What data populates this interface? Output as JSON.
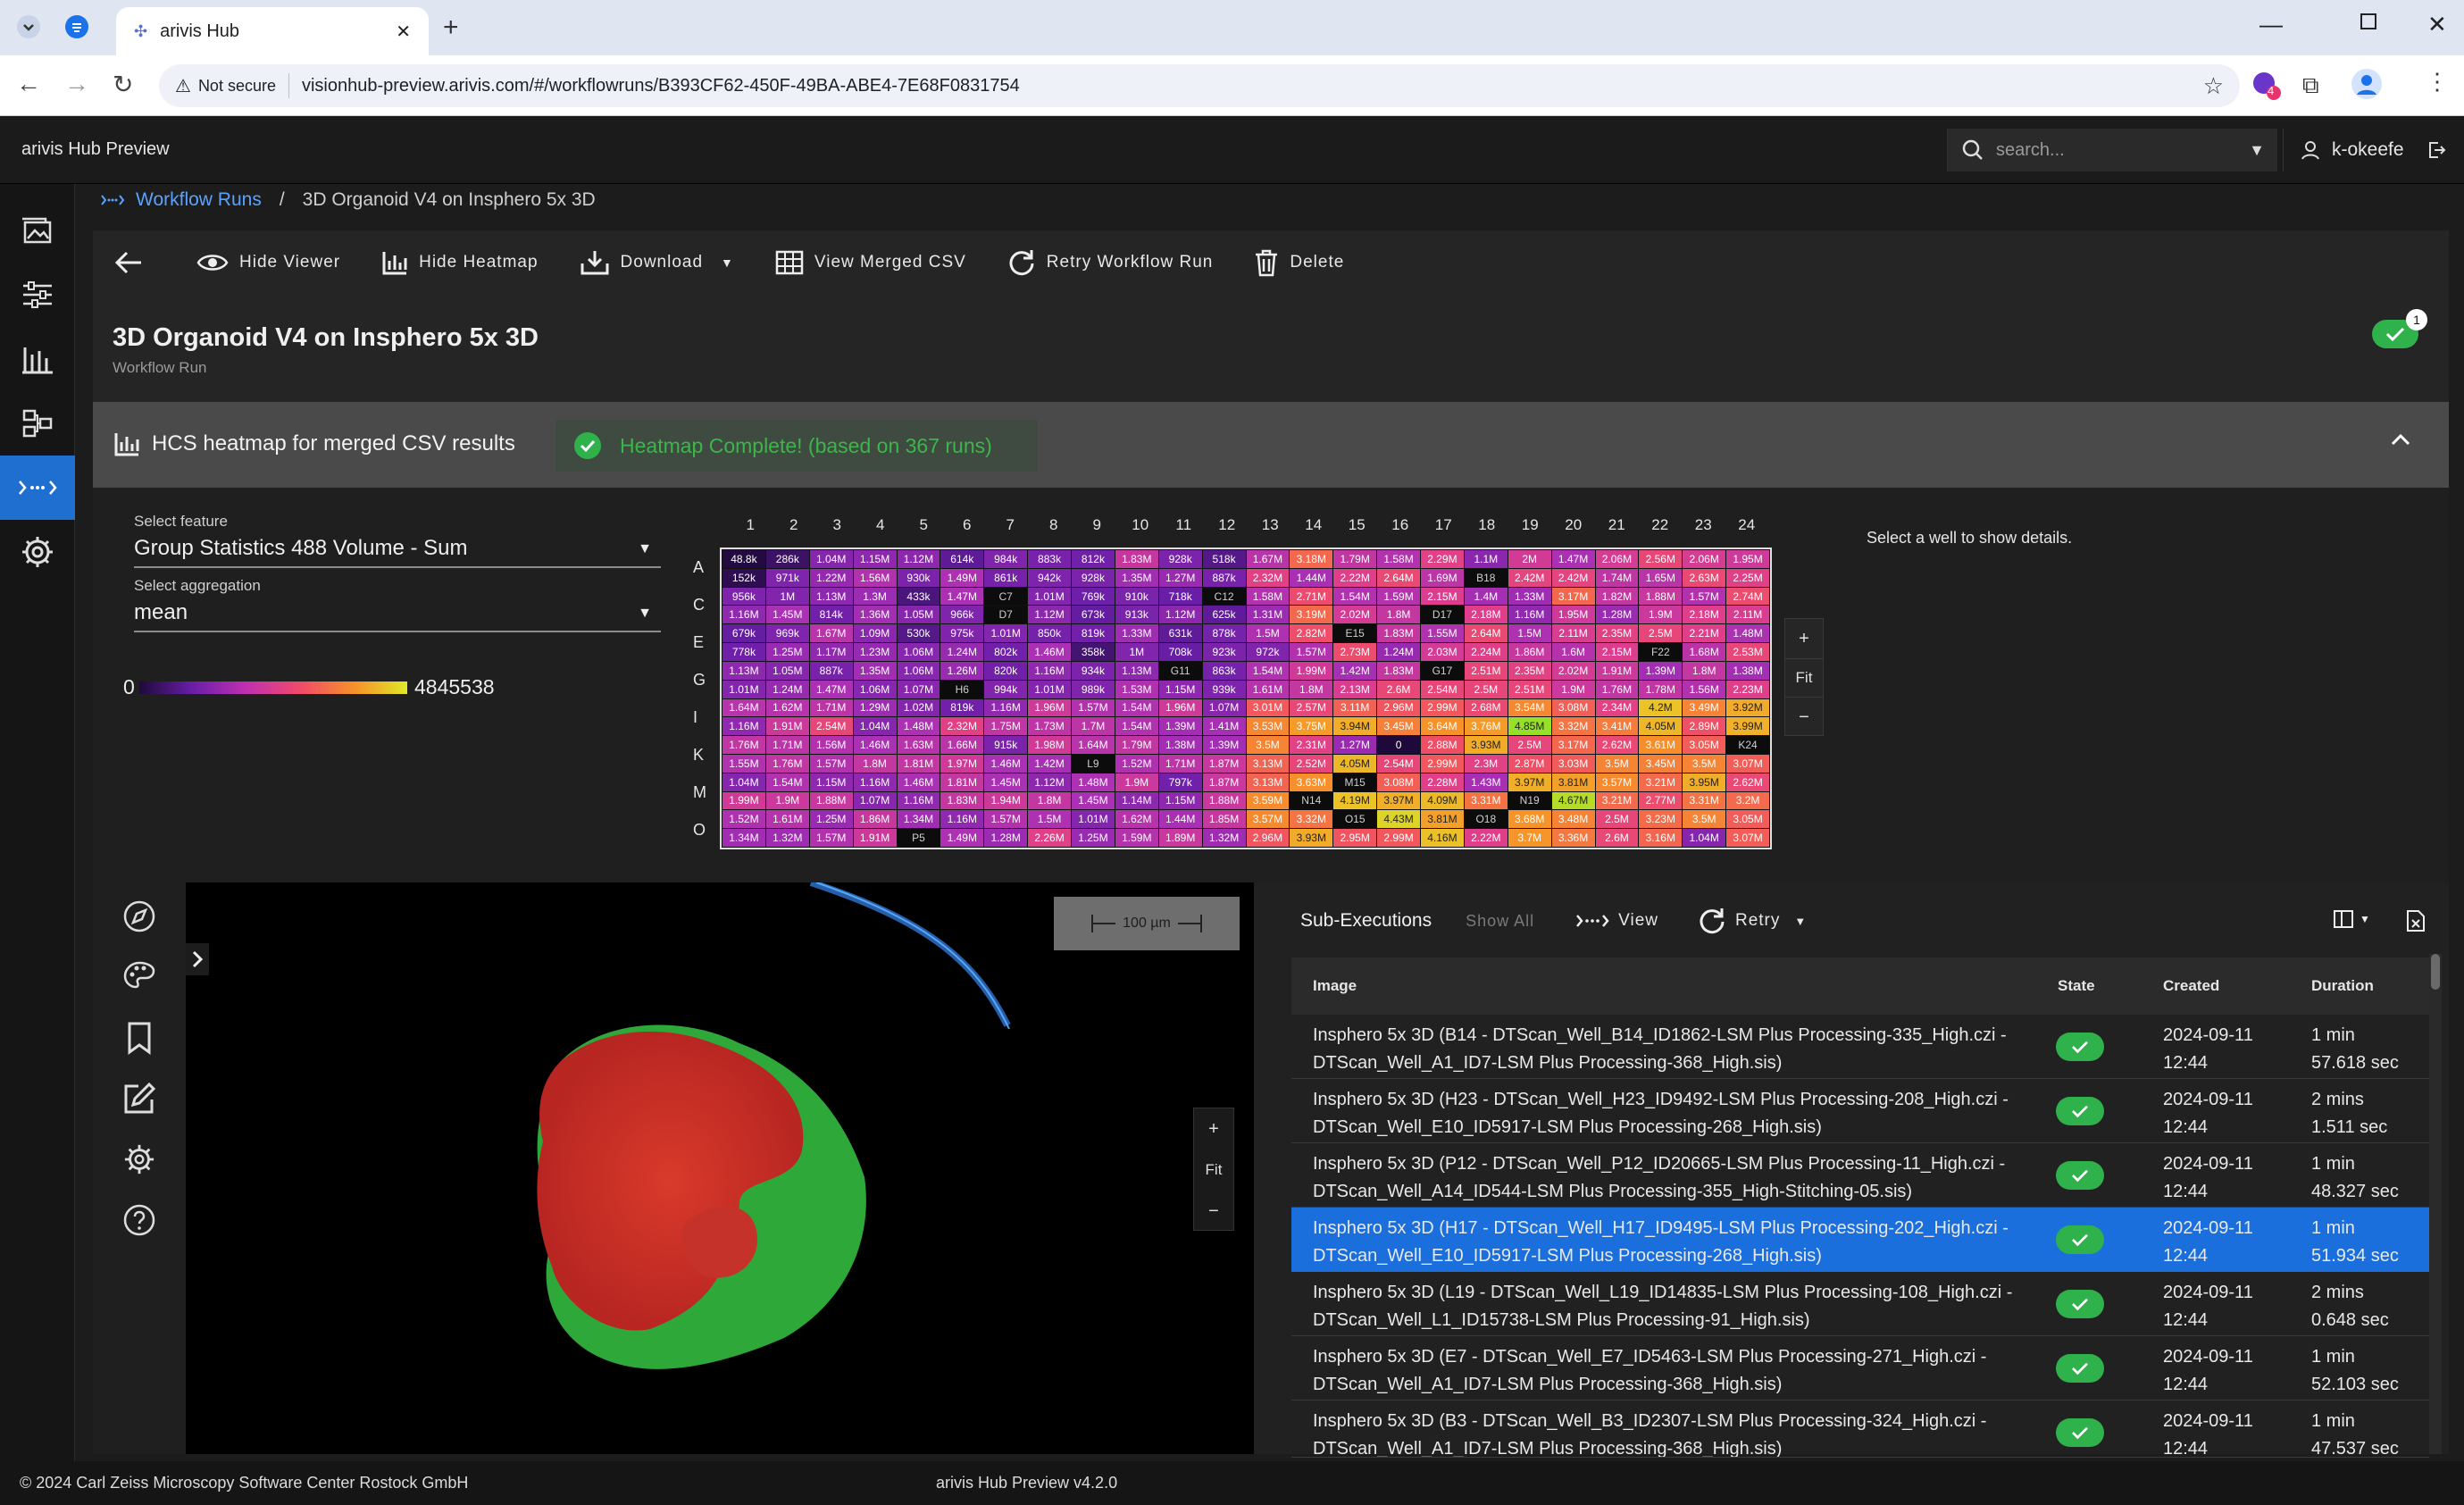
{
  "browser": {
    "tab_title": "arivis Hub",
    "not_secure": "Not secure",
    "url": "visionhub-preview.arivis.com/#/workflowruns/B393CF62-450F-49BA-ABE4-7E68F0831754",
    "extension_badge": "4"
  },
  "app": {
    "name": "arivis Hub Preview",
    "search_placeholder": "search...",
    "username": "k-okeefe"
  },
  "breadcrumb": {
    "parent": "Workflow Runs",
    "separator": "/",
    "current": "3D Organoid V4 on Insphero 5x 3D"
  },
  "toolbar": {
    "hide_viewer": "Hide Viewer",
    "hide_heatmap": "Hide Heatmap",
    "download": "Download",
    "view_csv": "View Merged CSV",
    "retry": "Retry Workflow Run",
    "delete": "Delete"
  },
  "page": {
    "title": "3D Organoid V4 on Insphero 5x 3D",
    "subtitle": "Workflow Run",
    "status_badge_count": "1"
  },
  "heatmap": {
    "section_title": "HCS heatmap for merged CSV results",
    "status": "Heatmap Complete! (based on 367 runs)",
    "feature_label": "Select feature",
    "feature_value": "Group Statistics 488 Volume - Sum",
    "aggregation_label": "Select aggregation",
    "aggregation_value": "mean",
    "scale_min": "0",
    "scale_max": "4845538",
    "well_hint": "Select a well to show details.",
    "zoom_in": "+",
    "zoom_fit": "Fit",
    "zoom_out": "−",
    "column_labels": [
      "1",
      "2",
      "3",
      "4",
      "5",
      "6",
      "7",
      "8",
      "9",
      "10",
      "11",
      "12",
      "13",
      "14",
      "15",
      "16",
      "17",
      "18",
      "19",
      "20",
      "21",
      "22",
      "23",
      "24"
    ],
    "row_labels": [
      "A",
      "C",
      "E",
      "G",
      "I",
      "K",
      "M",
      "O"
    ],
    "rows": [
      [
        "48.8k",
        "286k",
        "1.04M",
        "1.15M",
        "1.12M",
        "614k",
        "984k",
        "883k",
        "812k",
        "1.83M",
        "928k",
        "518k",
        "1.67M",
        "3.18M",
        "1.79M",
        "1.58M",
        "2.29M",
        "1.1M",
        "2M",
        "1.47M",
        "2.06M",
        "2.56M",
        "2.06M",
        "1.95M"
      ],
      [
        "152k",
        "971k",
        "1.22M",
        "1.56M",
        "930k",
        "1.49M",
        "861k",
        "942k",
        "928k",
        "1.35M",
        "1.27M",
        "887k",
        "2.32M",
        "1.44M",
        "2.22M",
        "2.64M",
        "1.69M",
        "B18",
        "2.42M",
        "2.42M",
        "1.74M",
        "1.65M",
        "2.63M",
        "2.25M"
      ],
      [
        "956k",
        "1M",
        "1.13M",
        "1.3M",
        "433k",
        "1.47M",
        "C7",
        "1.01M",
        "769k",
        "910k",
        "718k",
        "C12",
        "1.58M",
        "2.71M",
        "1.54M",
        "1.59M",
        "2.15M",
        "1.4M",
        "1.33M",
        "3.17M",
        "1.82M",
        "1.88M",
        "1.57M",
        "2.74M"
      ],
      [
        "1.16M",
        "1.45M",
        "814k",
        "1.36M",
        "1.05M",
        "966k",
        "D7",
        "1.12M",
        "673k",
        "913k",
        "1.12M",
        "625k",
        "1.31M",
        "3.19M",
        "2.02M",
        "1.8M",
        "D17",
        "2.18M",
        "1.16M",
        "1.95M",
        "1.28M",
        "1.9M",
        "2.18M",
        "2.11M"
      ],
      [
        "679k",
        "969k",
        "1.67M",
        "1.09M",
        "530k",
        "975k",
        "1.01M",
        "850k",
        "819k",
        "1.33M",
        "631k",
        "878k",
        "1.5M",
        "2.82M",
        "E15",
        "1.83M",
        "1.55M",
        "2.64M",
        "1.5M",
        "2.11M",
        "2.35M",
        "2.5M",
        "2.21M",
        "1.48M"
      ],
      [
        "778k",
        "1.25M",
        "1.17M",
        "1.23M",
        "1.06M",
        "1.24M",
        "802k",
        "1.46M",
        "358k",
        "1M",
        "708k",
        "923k",
        "972k",
        "1.57M",
        "2.73M",
        "1.24M",
        "2.03M",
        "2.24M",
        "1.86M",
        "1.6M",
        "2.15M",
        "F22",
        "1.68M",
        "2.53M"
      ],
      [
        "1.13M",
        "1.05M",
        "887k",
        "1.35M",
        "1.06M",
        "1.26M",
        "820k",
        "1.16M",
        "934k",
        "1.13M",
        "G11",
        "863k",
        "1.54M",
        "1.99M",
        "1.42M",
        "1.83M",
        "G17",
        "2.51M",
        "2.35M",
        "2.02M",
        "1.91M",
        "1.39M",
        "1.8M",
        "1.38M"
      ],
      [
        "1.01M",
        "1.24M",
        "1.47M",
        "1.06M",
        "1.07M",
        "H6",
        "994k",
        "1.01M",
        "989k",
        "1.53M",
        "1.15M",
        "939k",
        "1.61M",
        "1.8M",
        "2.13M",
        "2.6M",
        "2.54M",
        "2.5M",
        "2.51M",
        "1.9M",
        "1.76M",
        "1.78M",
        "1.56M",
        "2.23M"
      ],
      [
        "1.64M",
        "1.62M",
        "1.71M",
        "1.29M",
        "1.02M",
        "819k",
        "1.16M",
        "1.96M",
        "1.57M",
        "1.54M",
        "1.96M",
        "1.07M",
        "3.01M",
        "2.57M",
        "3.11M",
        "2.96M",
        "2.99M",
        "2.68M",
        "3.54M",
        "3.08M",
        "2.34M",
        "4.2M",
        "3.49M",
        "3.92M"
      ],
      [
        "1.16M",
        "1.91M",
        "2.54M",
        "1.04M",
        "1.48M",
        "2.32M",
        "1.75M",
        "1.73M",
        "1.7M",
        "1.54M",
        "1.39M",
        "1.41M",
        "3.53M",
        "3.75M",
        "3.94M",
        "3.45M",
        "3.64M",
        "3.76M",
        "4.85M",
        "3.32M",
        "3.41M",
        "4.05M",
        "2.89M",
        "3.99M"
      ],
      [
        "1.76M",
        "1.71M",
        "1.56M",
        "1.46M",
        "1.63M",
        "1.66M",
        "915k",
        "1.98M",
        "1.64M",
        "1.79M",
        "1.38M",
        "1.39M",
        "3.5M",
        "2.31M",
        "1.27M",
        "0",
        "2.88M",
        "3.93M",
        "2.5M",
        "3.17M",
        "2.62M",
        "3.61M",
        "3.05M",
        "K24"
      ],
      [
        "1.55M",
        "1.76M",
        "1.57M",
        "1.8M",
        "1.81M",
        "1.97M",
        "1.46M",
        "1.42M",
        "L9",
        "1.52M",
        "1.71M",
        "1.87M",
        "3.13M",
        "2.52M",
        "4.05M",
        "2.54M",
        "2.99M",
        "2.3M",
        "2.87M",
        "3.03M",
        "3.5M",
        "3.45M",
        "3.5M",
        "3.07M"
      ],
      [
        "1.04M",
        "1.54M",
        "1.15M",
        "1.16M",
        "1.46M",
        "1.81M",
        "1.45M",
        "1.12M",
        "1.48M",
        "1.9M",
        "797k",
        "1.87M",
        "3.13M",
        "3.63M",
        "M15",
        "3.08M",
        "2.28M",
        "1.43M",
        "3.97M",
        "3.81M",
        "3.57M",
        "3.21M",
        "3.95M",
        "2.62M"
      ],
      [
        "1.99M",
        "1.9M",
        "1.88M",
        "1.07M",
        "1.16M",
        "1.83M",
        "1.94M",
        "1.8M",
        "1.45M",
        "1.14M",
        "1.15M",
        "1.88M",
        "3.59M",
        "N14",
        "4.19M",
        "3.97M",
        "4.09M",
        "3.31M",
        "N19",
        "4.67M",
        "3.21M",
        "2.77M",
        "3.31M",
        "3.2M"
      ],
      [
        "1.52M",
        "1.61M",
        "1.25M",
        "1.86M",
        "1.34M",
        "1.16M",
        "1.57M",
        "1.5M",
        "1.01M",
        "1.62M",
        "1.44M",
        "1.85M",
        "3.57M",
        "3.32M",
        "O15",
        "4.43M",
        "3.81M",
        "O18",
        "3.68M",
        "3.48M",
        "2.5M",
        "3.23M",
        "3.5M",
        "3.05M"
      ],
      [
        "1.34M",
        "1.32M",
        "1.57M",
        "1.91M",
        "P5",
        "1.49M",
        "1.28M",
        "2.26M",
        "1.25M",
        "1.59M",
        "1.89M",
        "1.32M",
        "2.96M",
        "3.93M",
        "2.95M",
        "2.99M",
        "4.16M",
        "2.22M",
        "3.7M",
        "3.36M",
        "2.6M",
        "3.16M",
        "1.04M",
        "3.07M"
      ]
    ]
  },
  "viewer": {
    "scale_label": "100 µm",
    "zoom_in": "+",
    "zoom_fit": "Fit",
    "zoom_out": "−"
  },
  "subexec": {
    "title": "Sub-Executions",
    "show_all": "Show All",
    "view": "View",
    "retry": "Retry",
    "columns": {
      "image": "Image",
      "state": "State",
      "created": "Created",
      "duration": "Duration"
    },
    "rows": [
      {
        "image": "Insphero 5x 3D (B14 - DTScan_Well_B14_ID1862-LSM Plus Processing-335_High.czi - DTScan_Well_A1_ID7-LSM Plus Processing-368_High.sis)",
        "created_date": "2024-09-11",
        "created_time": "12:44",
        "duration_1": "1 min",
        "duration_2": "57.618 sec"
      },
      {
        "image": "Insphero 5x 3D (H23 - DTScan_Well_H23_ID9492-LSM Plus Processing-208_High.czi - DTScan_Well_E10_ID5917-LSM Plus Processing-268_High.sis)",
        "created_date": "2024-09-11",
        "created_time": "12:44",
        "duration_1": "2 mins",
        "duration_2": "1.511 sec"
      },
      {
        "image": "Insphero 5x 3D (P12 - DTScan_Well_P12_ID20665-LSM Plus Processing-11_High.czi - DTScan_Well_A14_ID544-LSM Plus Processing-355_High-Stitching-05.sis)",
        "created_date": "2024-09-11",
        "created_time": "12:44",
        "duration_1": "1 min",
        "duration_2": "48.327 sec"
      },
      {
        "image": "Insphero 5x 3D (H17 - DTScan_Well_H17_ID9495-LSM Plus Processing-202_High.czi - DTScan_Well_E10_ID5917-LSM Plus Processing-268_High.sis)",
        "created_date": "2024-09-11",
        "created_time": "12:44",
        "duration_1": "1 min",
        "duration_2": "51.934 sec"
      },
      {
        "image": "Insphero 5x 3D (L19 - DTScan_Well_L19_ID14835-LSM Plus Processing-108_High.czi - DTScan_Well_L1_ID15738-LSM Plus Processing-91_High.sis)",
        "created_date": "2024-09-11",
        "created_time": "12:44",
        "duration_1": "2 mins",
        "duration_2": "0.648 sec"
      },
      {
        "image": "Insphero 5x 3D (E7 - DTScan_Well_E7_ID5463-LSM Plus Processing-271_High.czi - DTScan_Well_A1_ID7-LSM Plus Processing-368_High.sis)",
        "created_date": "2024-09-11",
        "created_time": "12:44",
        "duration_1": "1 min",
        "duration_2": "52.103 sec"
      },
      {
        "image": "Insphero 5x 3D (B3 - DTScan_Well_B3_ID2307-LSM Plus Processing-324_High.czi - DTScan_Well_A1_ID7-LSM Plus Processing-368_High.sis)",
        "created_date": "2024-09-11",
        "created_time": "12:44",
        "duration_1": "1 min",
        "duration_2": "47.537 sec"
      }
    ]
  },
  "footer": {
    "copyright": "© 2024 Carl Zeiss Microscopy Software Center Rostock GmbH",
    "version": "arivis Hub Preview v4.2.0"
  },
  "colors": {
    "accent": "#1f6fd1",
    "success": "#2fb24c",
    "selected_row": "#1a6fdc"
  }
}
